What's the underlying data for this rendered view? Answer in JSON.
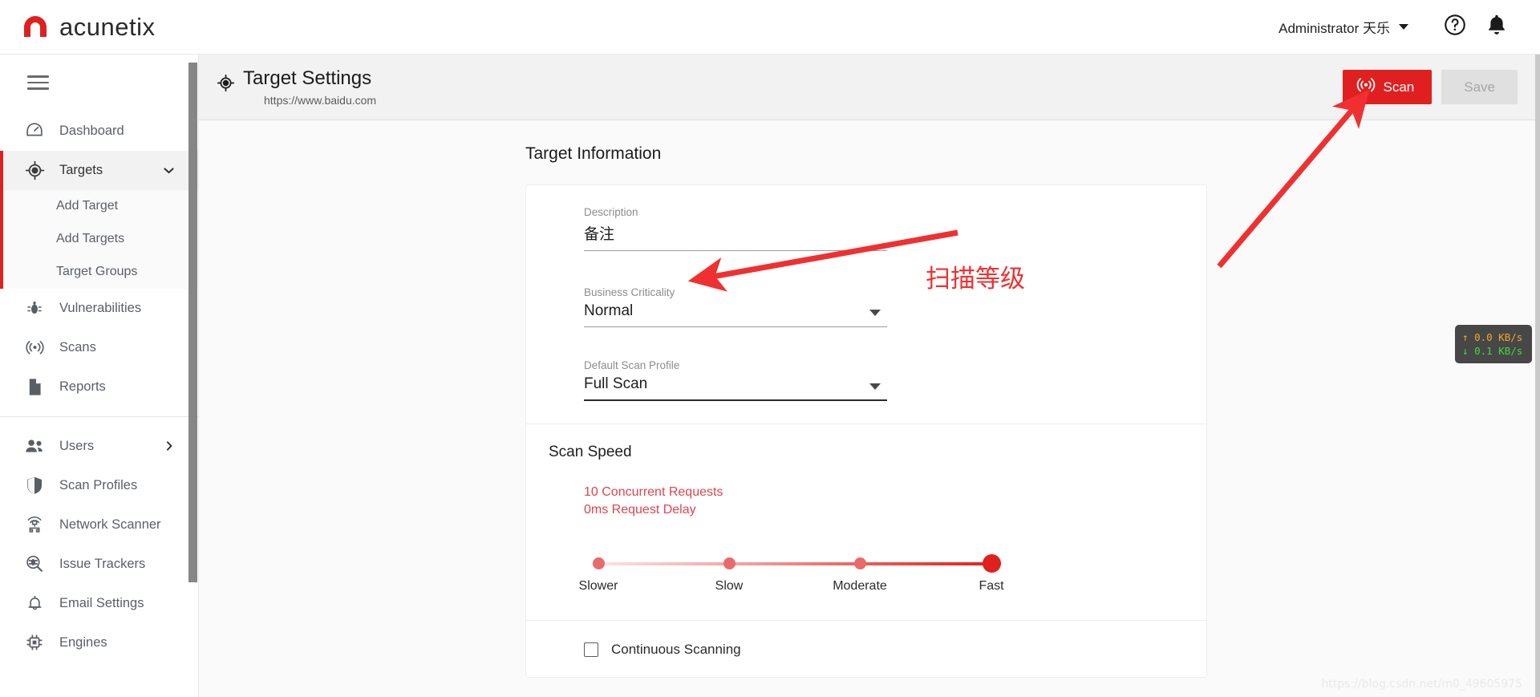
{
  "topbar": {
    "brand": "acunetix",
    "brand_icon": "acunetix-logo-icon",
    "user_label": "Administrator 天乐",
    "help_icon": "help-circle-icon",
    "notifications_icon": "bell-icon"
  },
  "sidebar": {
    "menu_icon": "hamburger-menu-icon",
    "items": [
      {
        "label": "Dashboard",
        "icon": "dashboard-gauge-icon",
        "active": false
      },
      {
        "label": "Targets",
        "icon": "target-crosshair-icon",
        "active": true,
        "expanded": true
      },
      {
        "label": "Vulnerabilities",
        "icon": "bug-icon",
        "active": false
      },
      {
        "label": "Scans",
        "icon": "radar-scan-icon",
        "active": false
      },
      {
        "label": "Reports",
        "icon": "document-icon",
        "active": false
      },
      {
        "label": "Users",
        "icon": "users-icon",
        "active": false,
        "has_submenu": true
      },
      {
        "label": "Scan Profiles",
        "icon": "shield-icon",
        "active": false
      },
      {
        "label": "Network Scanner",
        "icon": "network-scanner-icon",
        "active": false
      },
      {
        "label": "Issue Trackers",
        "icon": "issue-search-icon",
        "active": false
      },
      {
        "label": "Email Settings",
        "icon": "bell-outline-icon",
        "active": false
      },
      {
        "label": "Engines",
        "icon": "chip-engine-icon",
        "active": false
      }
    ],
    "targets_submenu": [
      {
        "label": "Add Target"
      },
      {
        "label": "Add Targets"
      },
      {
        "label": "Target Groups"
      }
    ]
  },
  "page_header": {
    "icon": "target-crosshair-icon",
    "title": "Target Settings",
    "subtitle": "https://www.baidu.com",
    "scan_button": "Scan",
    "scan_button_icon": "radar-scan-icon",
    "save_button": "Save",
    "save_disabled": true
  },
  "main": {
    "section_title": "Target Information",
    "description": {
      "label": "Description",
      "value": "备注"
    },
    "business_criticality": {
      "label": "Business Criticality",
      "value": "Normal"
    },
    "default_scan_profile": {
      "label": "Default Scan Profile",
      "value": "Full Scan"
    },
    "scan_speed": {
      "title": "Scan Speed",
      "concurrent_requests": "10 Concurrent Requests",
      "request_delay": "0ms Request Delay",
      "stops": [
        {
          "label": "Slower",
          "selected": false
        },
        {
          "label": "Slow",
          "selected": false
        },
        {
          "label": "Moderate",
          "selected": false
        },
        {
          "label": "Fast",
          "selected": true
        }
      ],
      "selected_value": "Fast"
    },
    "continuous_scanning": {
      "label": "Continuous Scanning",
      "checked": false
    }
  },
  "overlays": {
    "annotation_text": "扫描等级",
    "network_speed": {
      "upload": "0.0 KB/s",
      "download": "0.1 KB/s",
      "up_icon": "arrow-up-icon",
      "down_icon": "arrow-down-icon"
    },
    "watermark": "https://blog.csdn.net/m0_49605975"
  },
  "colors": {
    "brand_red": "#e02020",
    "accent_red": "#e0434e",
    "annotation_red": "#f03030",
    "sidebar_text": "#5a5f66",
    "upload_color": "#f5a623",
    "download_color": "#3ddb3d"
  }
}
